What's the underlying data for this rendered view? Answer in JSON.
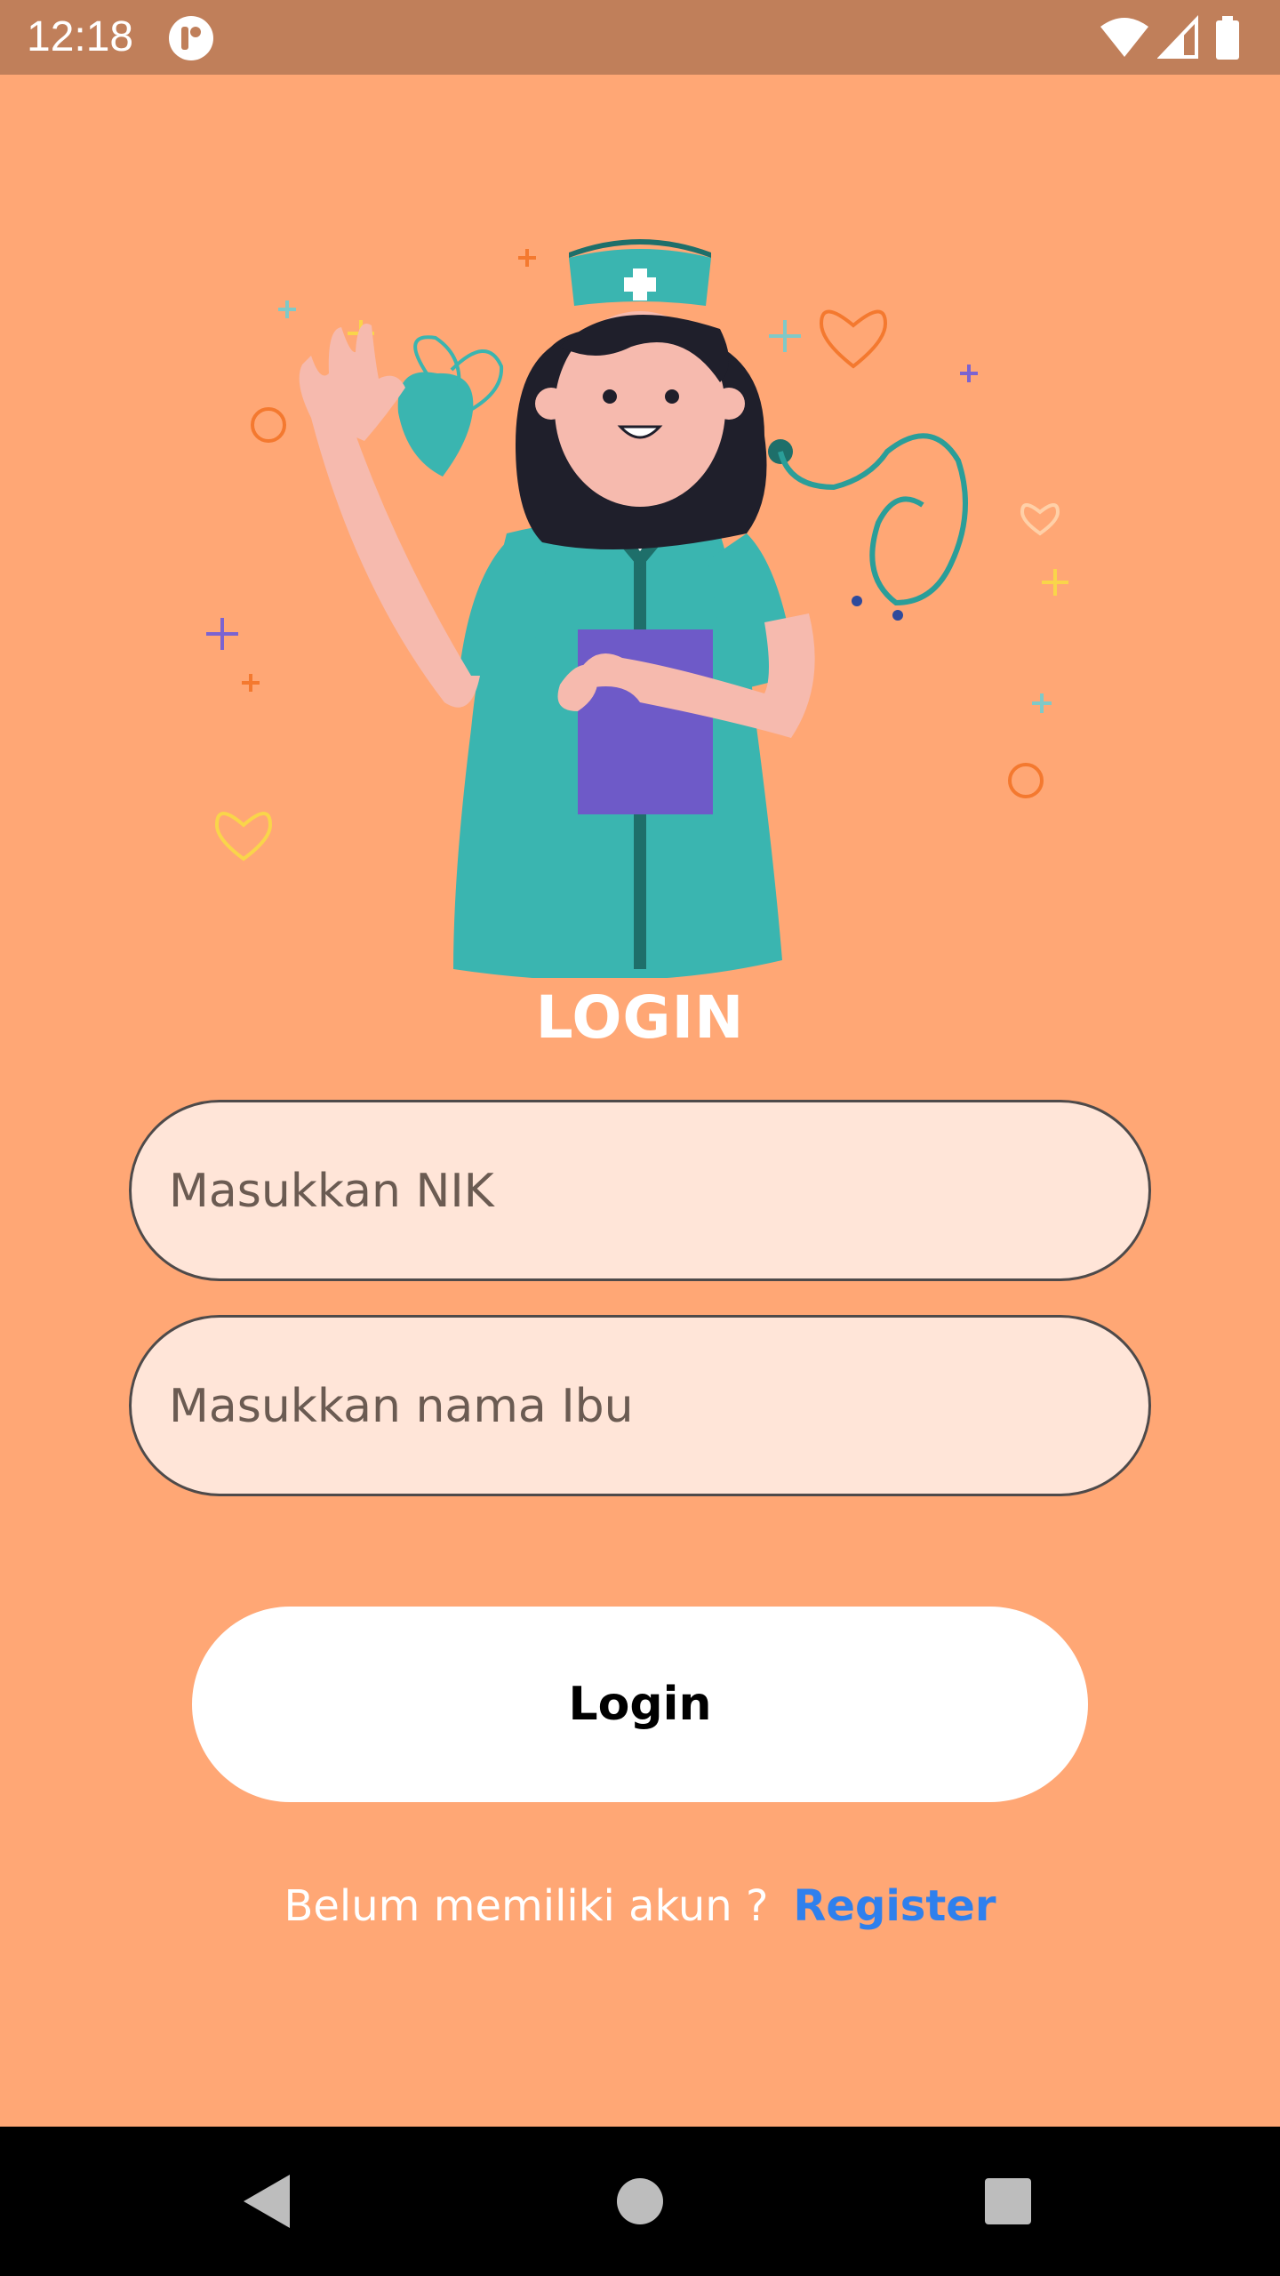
{
  "status_bar": {
    "time": "12:18",
    "icons": [
      "app-notification-icon",
      "wifi-icon",
      "signal-icon",
      "battery-icon"
    ]
  },
  "illustration": {
    "subject": "nurse-illustration"
  },
  "login": {
    "title": "LOGIN",
    "nik_placeholder": "Masukkan NIK",
    "mother_name_placeholder": "Masukkan nama Ibu",
    "button_label": "Login",
    "register_prompt": "Belum memiliki akun ?",
    "register_link": "Register"
  },
  "nav_bar": {
    "icons": [
      "back-icon",
      "home-icon",
      "recents-icon"
    ]
  },
  "colors": {
    "background": "#FFA775",
    "status_bar": "#C07F5A",
    "input_fill": "#FFE5D8",
    "button_fill": "#FFFFFF",
    "link": "#2F80ED",
    "nav_bar": "#000000"
  }
}
